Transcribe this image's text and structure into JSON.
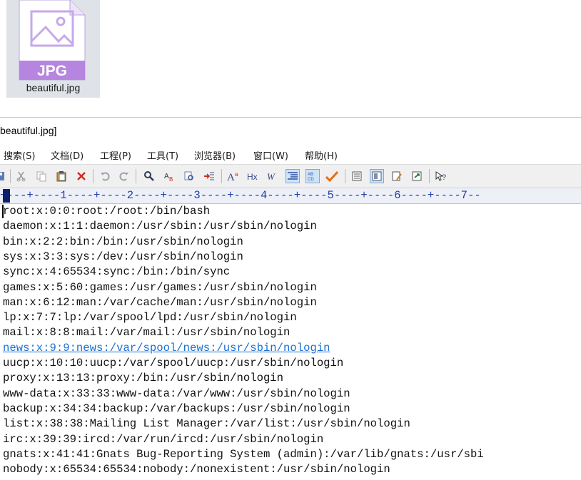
{
  "desktop": {
    "file_badge": "JPG",
    "file_name": "beautiful.jpg"
  },
  "window": {
    "title": "beautiful.jpg]"
  },
  "menu": [
    {
      "label": "搜索(S)"
    },
    {
      "label": "文档(D)"
    },
    {
      "label": "工程(P)"
    },
    {
      "label": "工具(T)"
    },
    {
      "label": "浏览器(B)"
    },
    {
      "label": "窗口(W)"
    },
    {
      "label": "帮助(H)"
    }
  ],
  "ruler": "+---+----1----+----2----+----3----+----4----+----5----+----6----+----7--",
  "editor": {
    "lines": [
      "root:x:0:0:root:/root:/bin/bash",
      "daemon:x:1:1:daemon:/usr/sbin:/usr/sbin/nologin",
      "bin:x:2:2:bin:/bin:/usr/sbin/nologin",
      "sys:x:3:3:sys:/dev:/usr/sbin/nologin",
      "sync:x:4:65534:sync:/bin:/bin/sync",
      "games:x:5:60:games:/usr/games:/usr/sbin/nologin",
      "man:x:6:12:man:/var/cache/man:/usr/sbin/nologin",
      "lp:x:7:7:lp:/var/spool/lpd:/usr/sbin/nologin",
      "mail:x:8:8:mail:/var/mail:/usr/sbin/nologin",
      "news:x:9:9:news:/var/spool/news:/usr/sbin/nologin",
      "uucp:x:10:10:uucp:/var/spool/uucp:/usr/sbin/nologin",
      "proxy:x:13:13:proxy:/bin:/usr/sbin/nologin",
      "www-data:x:33:33:www-data:/var/www:/usr/sbin/nologin",
      "backup:x:34:34:backup:/var/backups:/usr/sbin/nologin",
      "list:x:38:38:Mailing List Manager:/var/list:/usr/sbin/nologin",
      "irc:x:39:39:ircd:/var/run/ircd:/usr/sbin/nologin",
      "gnats:x:41:41:Gnats Bug-Reporting System (admin):/var/lib/gnats:/usr/sbi",
      "nobody:x:65534:65534:nobody:/nonexistent:/usr/sbin/nologin"
    ]
  },
  "colors": {
    "link": "#1a6fd1",
    "ruler_text": "#1f3fa8",
    "jpg_badge": "#b685e0"
  }
}
